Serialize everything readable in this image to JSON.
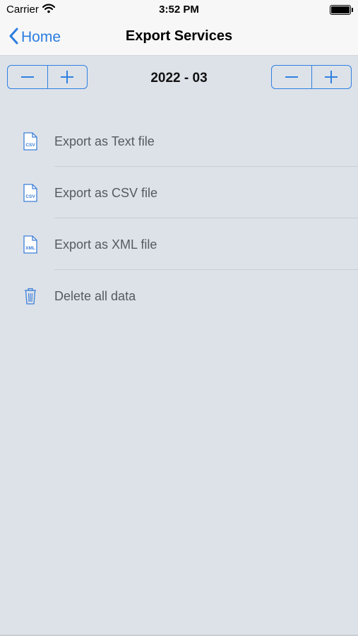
{
  "status": {
    "carrier": "Carrier",
    "time": "3:52 PM"
  },
  "nav": {
    "back_label": "Home",
    "title": "Export Services"
  },
  "period": {
    "label": "2022 - 03"
  },
  "steppers": {
    "left": {
      "minus": "−",
      "plus": "+"
    },
    "right": {
      "minus": "−",
      "plus": "+"
    }
  },
  "menu": {
    "items": [
      {
        "label": "Export as Text file",
        "icon": "csv-file-icon",
        "badge": "CSV"
      },
      {
        "label": "Export as CSV file",
        "icon": "csv-file-icon",
        "badge": "CSV"
      },
      {
        "label": "Export as XML file",
        "icon": "xml-file-icon",
        "badge": "XML"
      },
      {
        "label": "Delete all data",
        "icon": "trash-icon"
      }
    ]
  },
  "colors": {
    "accent": "#2f80e0",
    "background": "#dde2e9",
    "bar": "#f7f7f7",
    "text": "#555a60"
  }
}
